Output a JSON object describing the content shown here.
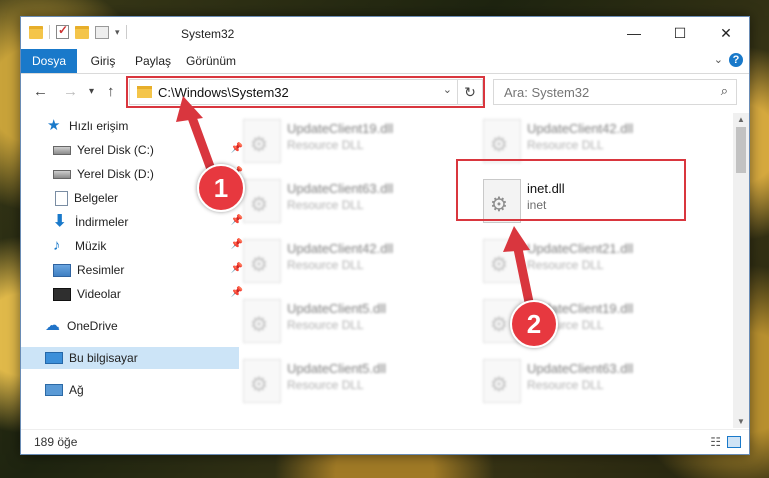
{
  "window": {
    "title": "System32",
    "controls": {
      "minimize": "—",
      "maximize": "☐",
      "close": "✕"
    }
  },
  "ribbon": {
    "tabs": [
      {
        "label": "Dosya"
      },
      {
        "label": "Giriş"
      },
      {
        "label": "Paylaş"
      },
      {
        "label": "Görünüm"
      }
    ],
    "help": "?"
  },
  "nav": {
    "address": "C:\\Windows\\System32",
    "search_placeholder": "Ara: System32"
  },
  "sidebar": {
    "items": [
      {
        "label": "Hızlı erişim"
      },
      {
        "label": "Yerel Disk (C:)"
      },
      {
        "label": "Yerel Disk (D:)"
      },
      {
        "label": "Belgeler"
      },
      {
        "label": "İndirmeler"
      },
      {
        "label": "Müzik"
      },
      {
        "label": "Resimler"
      },
      {
        "label": "Videolar"
      },
      {
        "label": "OneDrive"
      },
      {
        "label": "Bu bilgisayar"
      },
      {
        "label": "Ağ"
      }
    ]
  },
  "files": [
    {
      "name": "UpdateClient19.dll",
      "desc": "Resource DLL"
    },
    {
      "name": "UpdateClient42.dll",
      "desc": "Resource DLL"
    },
    {
      "name": "UpdateClient63.dll",
      "desc": "Resource DLL"
    },
    {
      "name": "inet.dll",
      "desc": "inet"
    },
    {
      "name": "UpdateClient42.dll",
      "desc": "Resource DLL"
    },
    {
      "name": "UpdateClient21.dll",
      "desc": "Resource DLL"
    },
    {
      "name": "UpdateClient5.dll",
      "desc": "Resource DLL"
    },
    {
      "name": "UpdateClient19.dll",
      "desc": "Resource DLL"
    },
    {
      "name": "UpdateClient5.dll",
      "desc": "Resource DLL"
    },
    {
      "name": "UpdateClient63.dll",
      "desc": "Resource DLL"
    }
  ],
  "status": {
    "count": "189 öğe"
  },
  "annotations": {
    "step1": "1",
    "step2": "2",
    "highlight_color": "#d9363e"
  }
}
